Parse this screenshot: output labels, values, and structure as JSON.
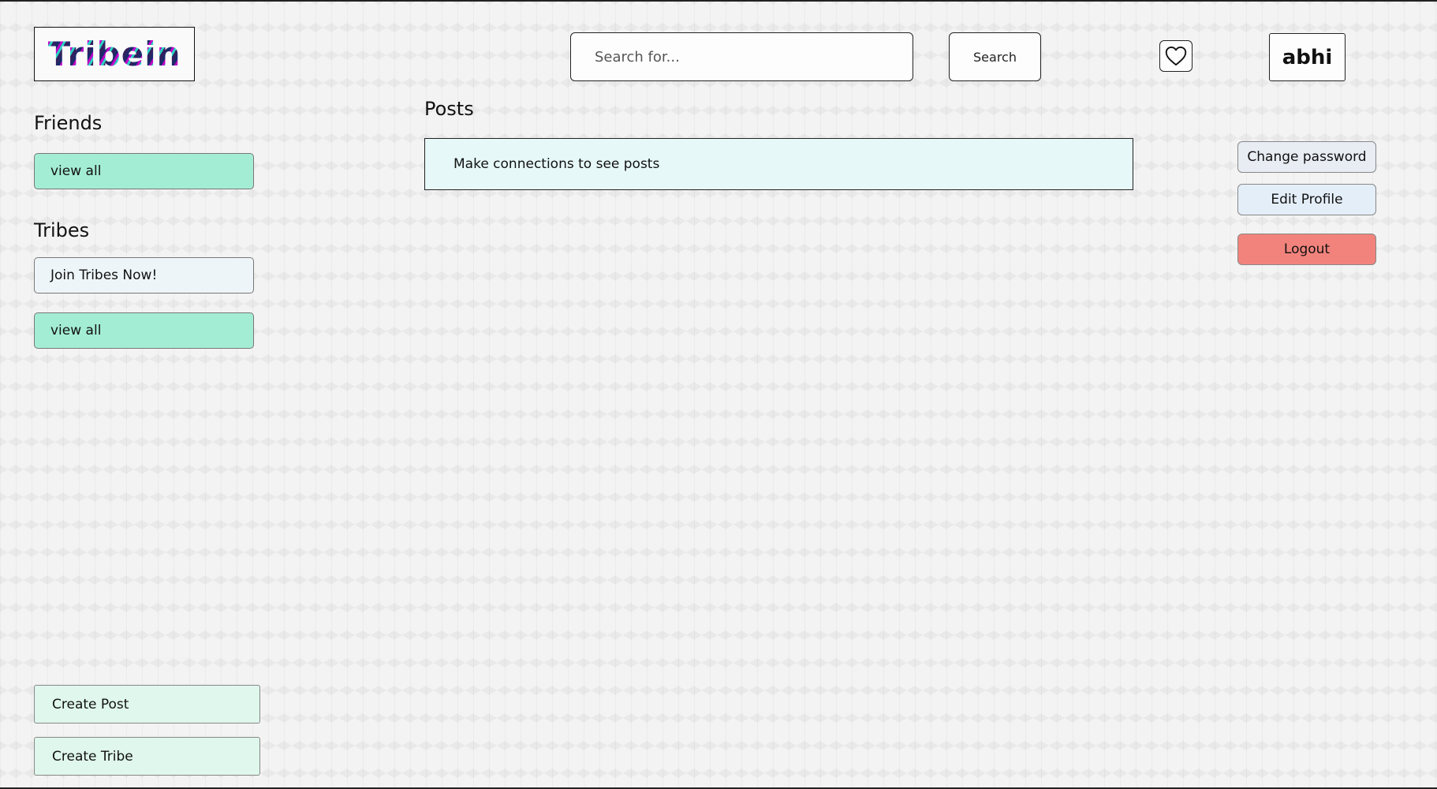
{
  "header": {
    "logo_text": "Tribein",
    "search_placeholder": "Search for...",
    "search_value": "",
    "search_button_label": "Search",
    "heart_icon": "heart-icon",
    "username": "abhi"
  },
  "left": {
    "friends_title": "Friends",
    "friends_view_all": "view all",
    "tribes_title": "Tribes",
    "join_tribes": "Join Tribes Now!",
    "tribes_view_all": "view all",
    "create_post": "Create Post",
    "create_tribe": "Create Tribe"
  },
  "main": {
    "posts_title": "Posts",
    "empty_message": "Make connections to see posts"
  },
  "right": {
    "change_password": "Change password",
    "edit_profile": "Edit Profile",
    "logout": "Logout"
  },
  "colors": {
    "green_button": "#a4edd5",
    "logout_button": "#f2837c",
    "posts_box": "#e6f8f8"
  }
}
